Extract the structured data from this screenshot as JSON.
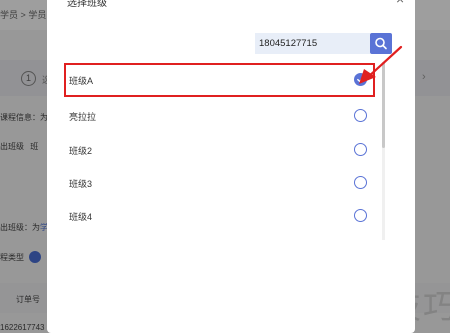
{
  "background": {
    "breadcrumb": [
      "学员",
      ">",
      "学员"
    ],
    "steps": {
      "number": "1",
      "label": "选"
    },
    "labels": {
      "course_info": "课程信息：为",
      "course_info_link": "学",
      "out_class": "出班级",
      "out_class_value": "班",
      "out_class2": "出班级：为",
      "out_class2_link": "学",
      "course_type": "程类型"
    },
    "table": {
      "col_order": "订单号",
      "row_order": "1622617743"
    },
    "chevron": "›"
  },
  "modal": {
    "title": "选择班级",
    "close": "×",
    "search": {
      "value": "18045127715",
      "placeholder": ""
    },
    "items": [
      {
        "label": "班级A",
        "selected": true
      },
      {
        "label": "亮拉拉",
        "selected": false
      },
      {
        "label": "班级2",
        "selected": false
      },
      {
        "label": "班级3",
        "selected": false
      },
      {
        "label": "班级4",
        "selected": false
      }
    ]
  },
  "watermark": "软件技巧",
  "colors": {
    "accent": "#5a73d6",
    "highlight": "#e02020"
  }
}
